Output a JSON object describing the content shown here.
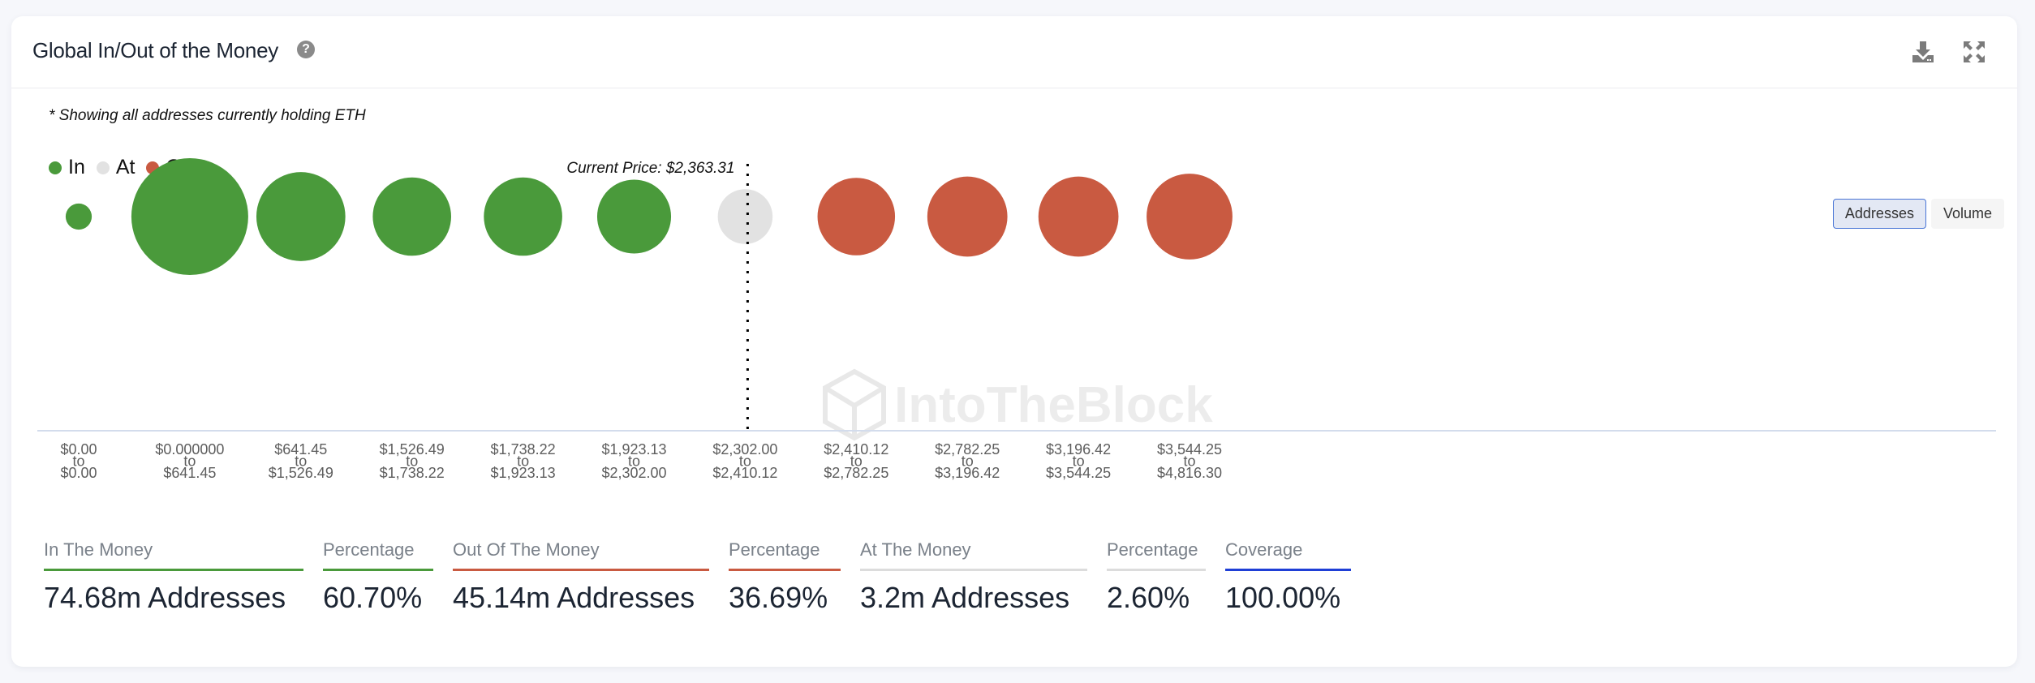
{
  "header": {
    "title": "Global In/Out of the Money",
    "help_icon": "question-circle-icon",
    "download_icon": "download-icon",
    "expand_icon": "expand-icon"
  },
  "note": "* Showing all addresses currently holding ETH",
  "legend": [
    {
      "label": "In",
      "color": "#4a9a3b"
    },
    {
      "label": "At",
      "color": "#e2e2e2"
    },
    {
      "label": "Out",
      "color": "#c95a41"
    }
  ],
  "toggle": {
    "options": [
      "Addresses",
      "Volume"
    ],
    "selected": "Addresses"
  },
  "colors": {
    "in": "#4a9a3b",
    "at": "#e2e2e2",
    "out": "#c95a41",
    "coverage": "#1f3fd6",
    "axis": "#d3dcec"
  },
  "chart_data": {
    "type": "scatter",
    "subtype": "bubble",
    "title": "Global In/Out of the Money",
    "watermark": "IntoTheBlock",
    "current_price_label": "Current Price: $2,363.31",
    "current_price": 2363.31,
    "current_price_after_bucket_index": 6,
    "measure": "Addresses",
    "categories": [
      {
        "from": "$0.00",
        "to": "$0.00",
        "status": "in",
        "relative_size": 0.05
      },
      {
        "from": "$0.000000",
        "to": "$641.45",
        "status": "in",
        "relative_size": 1.0
      },
      {
        "from": "$641.45",
        "to": "$1,526.49",
        "status": "in",
        "relative_size": 0.58
      },
      {
        "from": "$1,526.49",
        "to": "$1,738.22",
        "status": "in",
        "relative_size": 0.45
      },
      {
        "from": "$1,738.22",
        "to": "$1,923.13",
        "status": "in",
        "relative_size": 0.45
      },
      {
        "from": "$1,923.13",
        "to": "$2,302.00",
        "status": "in",
        "relative_size": 0.4
      },
      {
        "from": "$2,302.00",
        "to": "$2,410.12",
        "status": "at",
        "relative_size": 0.22
      },
      {
        "from": "$2,410.12",
        "to": "$2,782.25",
        "status": "out",
        "relative_size": 0.44
      },
      {
        "from": "$2,782.25",
        "to": "$3,196.42",
        "status": "out",
        "relative_size": 0.47
      },
      {
        "from": "$3,196.42",
        "to": "$3,544.25",
        "status": "out",
        "relative_size": 0.47
      },
      {
        "from": "$3,544.25",
        "to": "$4,816.30",
        "status": "out",
        "relative_size": 0.54
      }
    ],
    "connector": "to",
    "legend_position": "top-left"
  },
  "stats": [
    {
      "label": "In The Money",
      "value": "74.68m Addresses",
      "color_key": "in"
    },
    {
      "label": "Percentage",
      "value": "60.70%",
      "color_key": "in"
    },
    {
      "label": "Out Of The Money",
      "value": "45.14m Addresses",
      "color_key": "out"
    },
    {
      "label": "Percentage",
      "value": "36.69%",
      "color_key": "out"
    },
    {
      "label": "At The Money",
      "value": "3.2m Addresses",
      "color_key": "at"
    },
    {
      "label": "Percentage",
      "value": "2.60%",
      "color_key": "at"
    },
    {
      "label": "Coverage",
      "value": "100.00%",
      "color_key": "coverage"
    }
  ]
}
